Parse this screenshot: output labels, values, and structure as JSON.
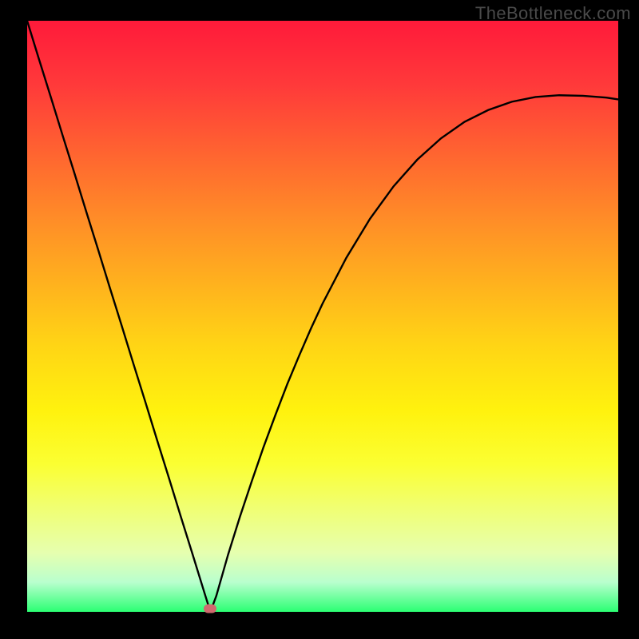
{
  "watermark": "TheBottleneck.com",
  "colors": {
    "top": "#ff1a3a",
    "bottom": "#2bff73",
    "curve": "#000000",
    "dot": "#d06a6e",
    "frame": "#000000"
  },
  "chart_data": {
    "type": "line",
    "title": "",
    "xlabel": "",
    "ylabel": "",
    "xlim": [
      0,
      100
    ],
    "ylim": [
      0,
      100
    ],
    "grid": false,
    "legend": false,
    "minimum_index": 31,
    "x": [
      0,
      2,
      4,
      6,
      8,
      10,
      12,
      14,
      16,
      18,
      20,
      22,
      24,
      26,
      28,
      30,
      31,
      32,
      34,
      36,
      38,
      40,
      42,
      44,
      46,
      48,
      50,
      54,
      58,
      62,
      66,
      70,
      74,
      78,
      82,
      86,
      90,
      94,
      98,
      100
    ],
    "y": [
      100,
      93.5,
      87.1,
      80.6,
      74.2,
      67.7,
      61.3,
      54.8,
      48.4,
      41.9,
      35.5,
      29.0,
      22.6,
      16.1,
      9.7,
      3.2,
      0,
      2.7,
      9.7,
      16.1,
      22.1,
      27.9,
      33.3,
      38.5,
      43.3,
      47.9,
      52.2,
      59.9,
      66.5,
      72.0,
      76.5,
      80.1,
      82.9,
      84.9,
      86.3,
      87.1,
      87.4,
      87.3,
      87.0,
      86.7
    ],
    "annotations": [
      {
        "type": "marker",
        "x": 31,
        "y": 0,
        "shape": "rounded",
        "color": "#d06a6e"
      }
    ]
  }
}
